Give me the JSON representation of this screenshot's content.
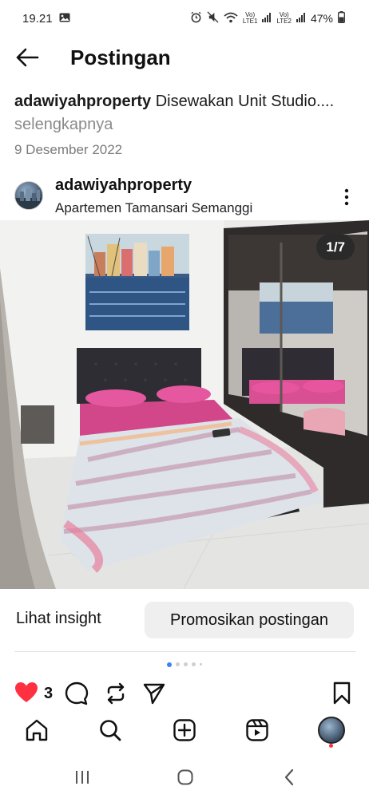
{
  "status_bar": {
    "time": "19.21",
    "battery": "47%",
    "lte1": "LTE1",
    "lte2": "LTE2",
    "vo": "Vo)"
  },
  "header": {
    "title": "Postingan"
  },
  "caption": {
    "username": "adawiyahproperty",
    "text": " Disewakan Unit Studio.... ",
    "more": "selengkapnya",
    "date": "9 Desember 2022"
  },
  "post": {
    "username": "adawiyahproperty",
    "location": "Apartemen Tamansari Semanggi",
    "counter": "1/7"
  },
  "insight_label": "Lihat insight",
  "promote_label": "Promosikan postingan",
  "actions": {
    "like_count": "3"
  },
  "colors": {
    "like": "#ff3040",
    "active_dot": "#3b82f6"
  }
}
